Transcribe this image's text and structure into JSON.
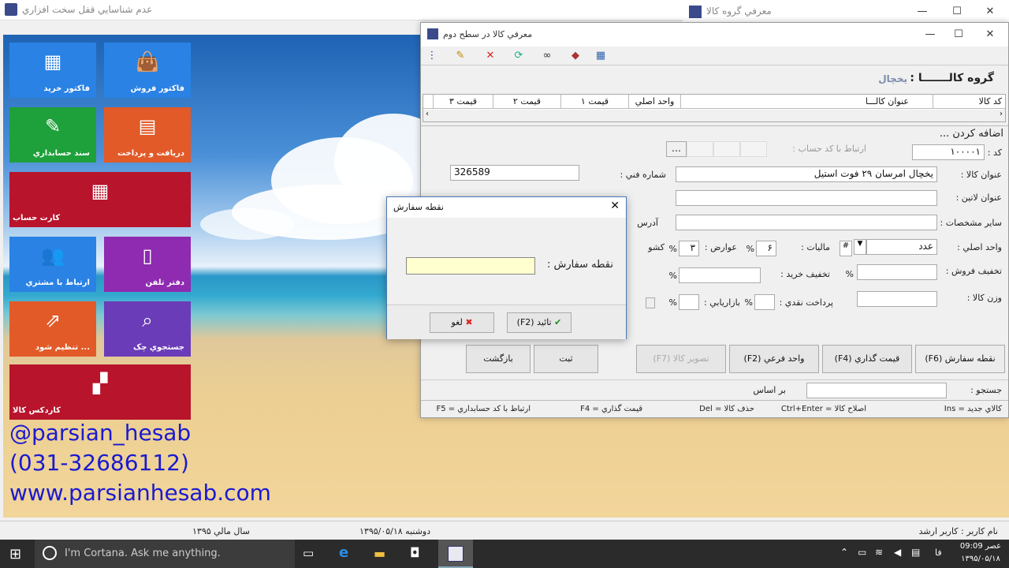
{
  "app": {
    "title": "عدم شناسايي قفل سخت افزاري"
  },
  "tiles": [
    {
      "label": "فاکتور خريد",
      "icon": "grid-star-icon",
      "color": "#2a82e4"
    },
    {
      "label": "فاکتور فروش",
      "icon": "shopping-bag-icon",
      "color": "#2a82e4"
    },
    {
      "label": "سند حسابداري",
      "icon": "edit-doc-icon",
      "color": "#1ea03a"
    },
    {
      "label": "دريافت و پرداخت",
      "icon": "calculator-icon",
      "color": "#e25a28"
    },
    {
      "label": "کارت حساب",
      "icon": "calendar-grid-icon",
      "color": "#b8142c"
    },
    {
      "label": "ارتباط با مشتري",
      "icon": "users-icon",
      "color": "#2a82e4"
    },
    {
      "label": "دفتر تلفن",
      "icon": "phone-icon",
      "color": "#8e2bb0"
    },
    {
      "label": "تنظيم شود ...",
      "icon": "external-link-icon",
      "color": "#e25a28"
    },
    {
      "label": "جستجوي چک",
      "icon": "search-screen-icon",
      "color": "#6a3cb8"
    },
    {
      "label": "کاردکس کالا",
      "icon": "blocks-icon",
      "color": "#b8142c"
    }
  ],
  "contact": {
    "social": "@parsian_hesab",
    "phone": "(031-32686112)",
    "web": "www.parsianhesab.com"
  },
  "group_window": {
    "title": "معرفي گروه کالا"
  },
  "item_window": {
    "title": "معرفي کالا در سطح دوم",
    "group_label": "گروه کالـــــــا :",
    "group_value": "يخچال",
    "table_headers": [
      "کد کالا",
      "عنوان کالـــا",
      "واحد اصلي",
      "قيمت ۱",
      "قيمت ۲",
      "قيمت ۳"
    ],
    "section_title": "اضافه کردن ...",
    "fields": {
      "code_label": "کد :",
      "code_value": "۱۰۰۰۰۱",
      "link_label": "ارتباط با کد حساب :",
      "title_label": "عنوان کالا :",
      "title_value": "يخچال امرسان ۲۹ فوت استيل",
      "tech_label": "شماره فني :",
      "tech_value": "326589",
      "latin_label": "عنوان لاتين :",
      "other_label": "ساير مشخصات :",
      "addr_label": "آدرس",
      "unit_label": "واحد اصلي :",
      "unit_value": "عدد",
      "tax_label": "ماليات :",
      "tax_value": "۶",
      "duty_label": "عوارض :",
      "duty_value": "۳",
      "kash_label": "کشو",
      "sale_disc_label": "تخفيف فروش :",
      "buy_disc_label": "تخفيف خريد :",
      "weight_label": "وزن کالا :",
      "cash_label": "پرداخت نقدي :",
      "market_label": "بازاريابي :",
      "percent": "%"
    },
    "buttons": {
      "order_point": "نقطه سفارش (F6)",
      "pricing": "قيمت گذاري (F4)",
      "sub_unit": "واحد فرعي (F2)",
      "image": "تصوير کالا (F7)",
      "save": "ثبت",
      "back": "بازگشت"
    },
    "search": {
      "label": "جستجو :",
      "based_on": "بر اساس"
    },
    "status": [
      "کالاي جديد = Ins",
      "اصلاح کالا = Ctrl+Enter",
      "حذف کالا = Del",
      "قيمت گذاري = F4",
      "ارتباط با کد حسابداري = F5"
    ]
  },
  "dialog": {
    "title": "نقطه سفارش",
    "label": "نقطه سفارش :",
    "input_value": "",
    "ok": "تائيد (F2)",
    "cancel": "لغو"
  },
  "app_status": {
    "user": "نام کاربر : کاربر ارشد",
    "date": "دوشنبه ۱۳۹۵/۰۵/۱۸",
    "year": "سال مالي ۱۳۹۵"
  },
  "taskbar": {
    "cortana": "I'm Cortana. Ask me anything.",
    "lang": "فا",
    "time": "عصر 09:09",
    "date": "۱۳۹۵/۰۵/۱۸"
  }
}
